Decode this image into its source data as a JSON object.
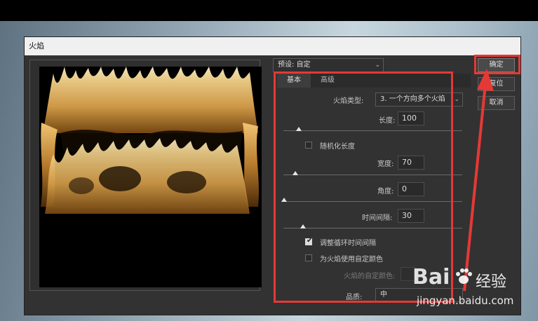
{
  "dialog": {
    "title": "火焰",
    "preset": {
      "label": "预设",
      "value": "自定"
    },
    "tabs": [
      "基本",
      "高级"
    ],
    "fields": {
      "flame_type": {
        "label": "火焰类型:",
        "value": "3. 一个方向多个火焰"
      },
      "length": {
        "label": "长度:",
        "value": "100",
        "slider": 0.1
      },
      "randomize_length": {
        "label": "随机化长度",
        "checked": false
      },
      "width": {
        "label": "宽度:",
        "value": "70",
        "slider": 0.07
      },
      "angle": {
        "label": "角度:",
        "value": "0",
        "slider": 0.0
      },
      "interval": {
        "label": "时间间隔:",
        "value": "30",
        "slider": 0.11
      },
      "adjust_loop": {
        "label": "调整循环时间间隔",
        "checked": true
      },
      "custom_color": {
        "label": "为火焰使用自定颜色",
        "checked": false
      },
      "flame_color_label": "火焰的自定颜色:",
      "quality": {
        "label": "品质:",
        "value": "中"
      }
    },
    "buttons": {
      "ok": "确定",
      "reset": "复位",
      "cancel": "取消"
    }
  },
  "watermark": {
    "brand": "Bai",
    "brand2": "经验",
    "url": "jingyan.baidu.com"
  },
  "colors": {
    "annotation": "#e53935",
    "dialog_bg": "#323232"
  }
}
